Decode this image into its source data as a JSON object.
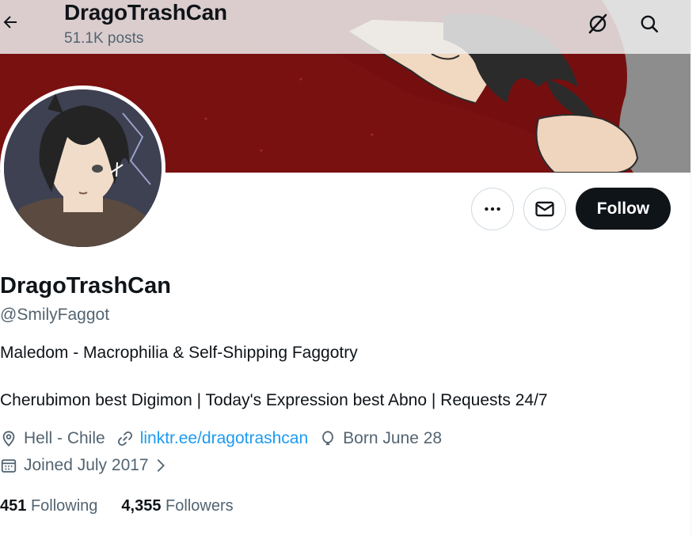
{
  "header": {
    "title": "DragoTrashCan",
    "posts": "51.1K posts",
    "back_icon": "arrow-left-icon",
    "grok_icon": "grok-icon",
    "search_icon": "search-icon"
  },
  "profile": {
    "display_name": "DragoTrashCan",
    "handle": "@SmilyFaggot",
    "bio_line1": "Maledom - Macrophilia & Self-Shipping Faggotry",
    "bio_line2": "Cherubimon best Digimon | Today's Expression best Abno | Requests 24/7",
    "location": "Hell - Chile",
    "website": "linktr.ee/dragotrashcan",
    "birthday": "Born June 28",
    "joined": "Joined July 2017",
    "following_count": "451",
    "following_label": "Following",
    "followers_count": "4,355",
    "followers_label": "Followers"
  },
  "actions": {
    "more_icon": "more-icon",
    "message_icon": "envelope-icon",
    "follow_label": "Follow"
  },
  "colors": {
    "text_primary": "#0f1419",
    "text_secondary": "#536471",
    "link": "#1d9bf0",
    "follow_bg": "#0f1419",
    "banner_red": "#6f0d0d"
  }
}
